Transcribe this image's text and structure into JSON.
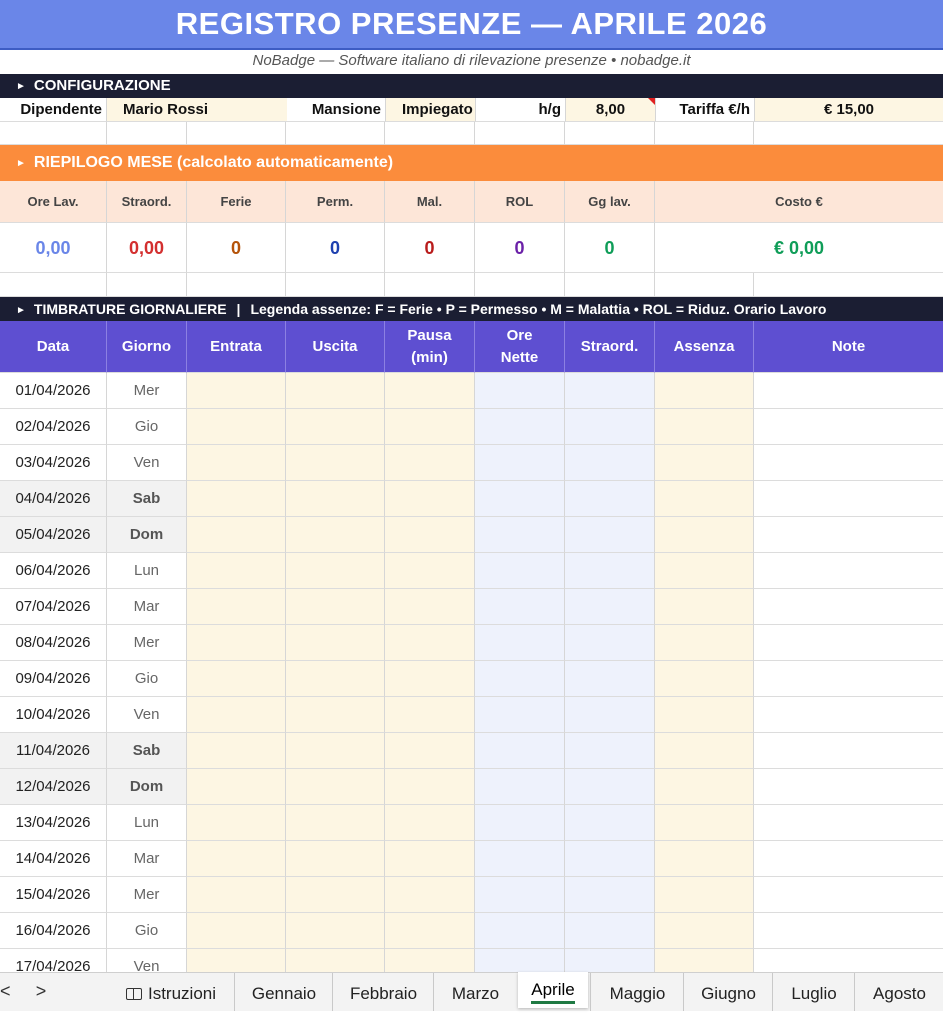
{
  "title": "REGISTRO PRESENZE — APRILE 2026",
  "subtitle": "NoBadge — Software italiano di rilevazione presenze • nobadge.it",
  "config": {
    "heading": "CONFIGURAZIONE",
    "dipendente_label": "Dipendente",
    "dipendente_value": "Mario Rossi",
    "mansione_label": "Mansione",
    "mansione_value": "Impiegato",
    "hg_label": "h/g",
    "hg_value": "8,00",
    "tariffa_label": "Tariffa €/h",
    "tariffa_value": "€ 15,00"
  },
  "summary": {
    "heading": "RIEPILOGO MESE (calcolato automaticamente)",
    "headers": [
      "Ore Lav.",
      "Straord.",
      "Ferie",
      "Perm.",
      "Mal.",
      "ROL",
      "Gg lav.",
      "Costo €"
    ],
    "values": [
      "0,00",
      "0,00",
      "0",
      "0",
      "0",
      "0",
      "0",
      "€ 0,00"
    ],
    "colors": [
      "#6a86e8",
      "#d32f2f",
      "#b45309",
      "#1e40af",
      "#b91c1c",
      "#6b21a8",
      "#0f9d58",
      "#0f9d58"
    ]
  },
  "timbrature": {
    "heading": "TIMBRATURE GIORNALIERE",
    "legend": "Legenda assenze:  F = Ferie  •  P = Permesso  •  M = Malattia  •  ROL = Riduz. Orario Lavoro",
    "columns": [
      "Data",
      "Giorno",
      "Entrata",
      "Uscita",
      "Pausa (min)",
      "Ore Nette",
      "Straord.",
      "Assenza",
      "Note"
    ],
    "rows": [
      {
        "date": "01/04/2026",
        "day": "Mer"
      },
      {
        "date": "02/04/2026",
        "day": "Gio"
      },
      {
        "date": "03/04/2026",
        "day": "Ven"
      },
      {
        "date": "04/04/2026",
        "day": "Sab"
      },
      {
        "date": "05/04/2026",
        "day": "Dom"
      },
      {
        "date": "06/04/2026",
        "day": "Lun"
      },
      {
        "date": "07/04/2026",
        "day": "Mar"
      },
      {
        "date": "08/04/2026",
        "day": "Mer"
      },
      {
        "date": "09/04/2026",
        "day": "Gio"
      },
      {
        "date": "10/04/2026",
        "day": "Ven"
      },
      {
        "date": "11/04/2026",
        "day": "Sab"
      },
      {
        "date": "12/04/2026",
        "day": "Dom"
      },
      {
        "date": "13/04/2026",
        "day": "Lun"
      },
      {
        "date": "14/04/2026",
        "day": "Mar"
      },
      {
        "date": "15/04/2026",
        "day": "Mer"
      },
      {
        "date": "16/04/2026",
        "day": "Gio"
      },
      {
        "date": "17/04/2026",
        "day": "Ven"
      }
    ]
  },
  "sheet_tabs": {
    "nav_prev": "<",
    "nav_next": ">",
    "items": [
      "Istruzioni",
      "Gennaio",
      "Febbraio",
      "Marzo",
      "Aprile",
      "Maggio",
      "Giugno",
      "Luglio",
      "Agosto"
    ],
    "active": "Aprile"
  }
}
